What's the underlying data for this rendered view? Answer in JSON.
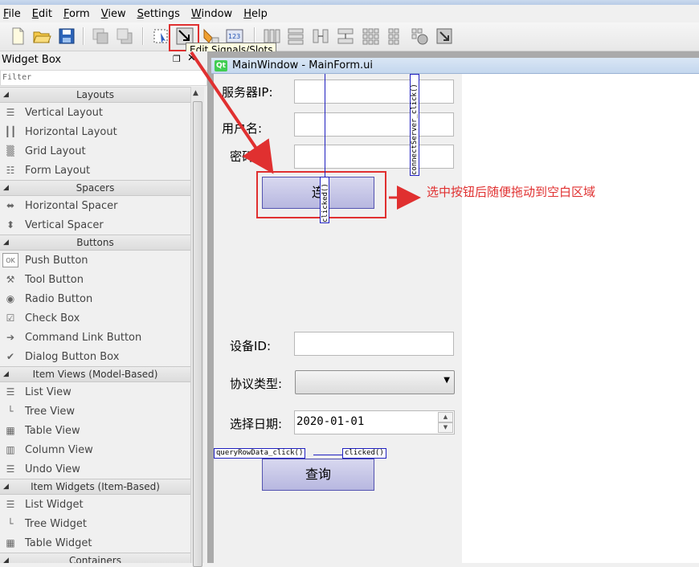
{
  "menubar": {
    "items": [
      "File",
      "Edit",
      "Form",
      "View",
      "Settings",
      "Window",
      "Help"
    ]
  },
  "toolbar": {
    "buttons": [
      "new-file-icon",
      "open-folder-icon",
      "save-icon",
      "send-to-back-icon",
      "bring-to-front-icon",
      "edit-widgets-icon",
      "edit-signals-slots-icon",
      "edit-buddies-icon",
      "edit-tab-order-icon",
      "lay-out-horizontally-icon",
      "lay-out-vertically-icon",
      "lay-out-horizontal-splitter-icon",
      "lay-out-vertical-splitter-icon",
      "lay-out-grid-icon",
      "lay-out-form-icon",
      "break-layout-icon",
      "adjust-size-icon"
    ],
    "tooltip": "Edit Signals/Slots"
  },
  "widget_box": {
    "title": "Widget Box",
    "filter_placeholder": "Filter",
    "categories": [
      {
        "name": "Layouts",
        "items": [
          {
            "label": "Vertical Layout",
            "icon": "vertical-layout-icon"
          },
          {
            "label": "Horizontal Layout",
            "icon": "horizontal-layout-icon"
          },
          {
            "label": "Grid Layout",
            "icon": "grid-layout-icon"
          },
          {
            "label": "Form Layout",
            "icon": "form-layout-icon"
          }
        ]
      },
      {
        "name": "Spacers",
        "items": [
          {
            "label": "Horizontal Spacer",
            "icon": "horizontal-spacer-icon"
          },
          {
            "label": "Vertical Spacer",
            "icon": "vertical-spacer-icon"
          }
        ]
      },
      {
        "name": "Buttons",
        "items": [
          {
            "label": "Push Button",
            "icon": "push-button-icon"
          },
          {
            "label": "Tool Button",
            "icon": "tool-button-icon"
          },
          {
            "label": "Radio Button",
            "icon": "radio-button-icon"
          },
          {
            "label": "Check Box",
            "icon": "check-box-icon"
          },
          {
            "label": "Command Link Button",
            "icon": "command-link-icon"
          },
          {
            "label": "Dialog Button Box",
            "icon": "dialog-button-box-icon"
          }
        ]
      },
      {
        "name": "Item Views (Model-Based)",
        "items": [
          {
            "label": "List View",
            "icon": "list-view-icon"
          },
          {
            "label": "Tree View",
            "icon": "tree-view-icon"
          },
          {
            "label": "Table View",
            "icon": "table-view-icon"
          },
          {
            "label": "Column View",
            "icon": "column-view-icon"
          },
          {
            "label": "Undo View",
            "icon": "undo-view-icon"
          }
        ]
      },
      {
        "name": "Item Widgets (Item-Based)",
        "items": [
          {
            "label": "List Widget",
            "icon": "list-widget-icon"
          },
          {
            "label": "Tree Widget",
            "icon": "tree-widget-icon"
          },
          {
            "label": "Table Widget",
            "icon": "table-widget-icon"
          }
        ]
      },
      {
        "name": "Containers",
        "items": []
      }
    ]
  },
  "design": {
    "window_title": "MainWindow - MainForm.ui",
    "qt_logo": "Qt",
    "labels": {
      "server_ip": "服务器IP:",
      "username": "用户名:",
      "password": "密码:",
      "device_id": "设备ID:",
      "protocol_type": "协议类型:",
      "select_date": "选择日期:"
    },
    "connect_button": "连",
    "query_button": "查询",
    "date_value": "2020-01-01",
    "connections": {
      "connect_slot": "connectServer_click()",
      "connect_signal": "clicked()",
      "query_slot": "queryRowData_click()",
      "query_signal": "clicked()"
    },
    "annotation": "选中按钮后随便拖动到空白区域",
    "annotation_color": "#e03030",
    "connection_color": "#2020c0"
  }
}
